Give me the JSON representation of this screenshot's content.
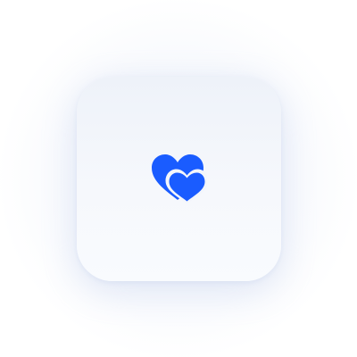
{
  "app_icon": {
    "icon_name": "two-hearts-icon",
    "accent_color": "#1a5cff",
    "tile_color": "#f3f6fb"
  }
}
